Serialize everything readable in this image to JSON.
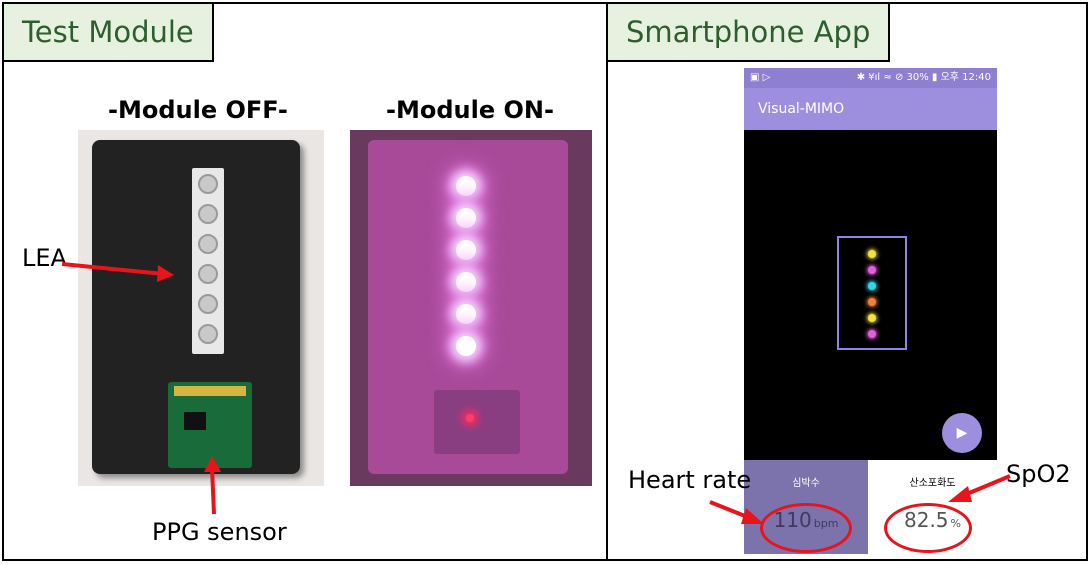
{
  "left_panel": {
    "tab_title": "Test Module",
    "caption_off": "-Module OFF-",
    "caption_on": "-Module ON-",
    "label_lea": "LEA",
    "label_ppg": "PPG sensor"
  },
  "right_panel": {
    "tab_title": "Smartphone App",
    "statusbar": {
      "left_icons": "▣ ▷",
      "right_text": "✱ ¥ıl ≈ ⊘ 30% ▮ 오후 12:40"
    },
    "app_title": "Visual-MIMO",
    "fab_icon": "play-icon",
    "heart_rate": {
      "title": "심박수",
      "value": "110",
      "unit": "bpm"
    },
    "spo2": {
      "title": "산소포화도",
      "value": "82.5",
      "unit": "%"
    },
    "label_heart_rate": "Heart rate",
    "label_spo2": "SpO2",
    "led_colors": [
      "#f4e13a",
      "#e45fdd",
      "#35d4e8",
      "#f2803a",
      "#f4e13a",
      "#e45fdd"
    ]
  },
  "colors": {
    "tab_bg": "#e6f2df",
    "tab_text": "#2e5e2e",
    "annotation_red": "#e8141b",
    "app_accent": "#9d8fdd"
  }
}
